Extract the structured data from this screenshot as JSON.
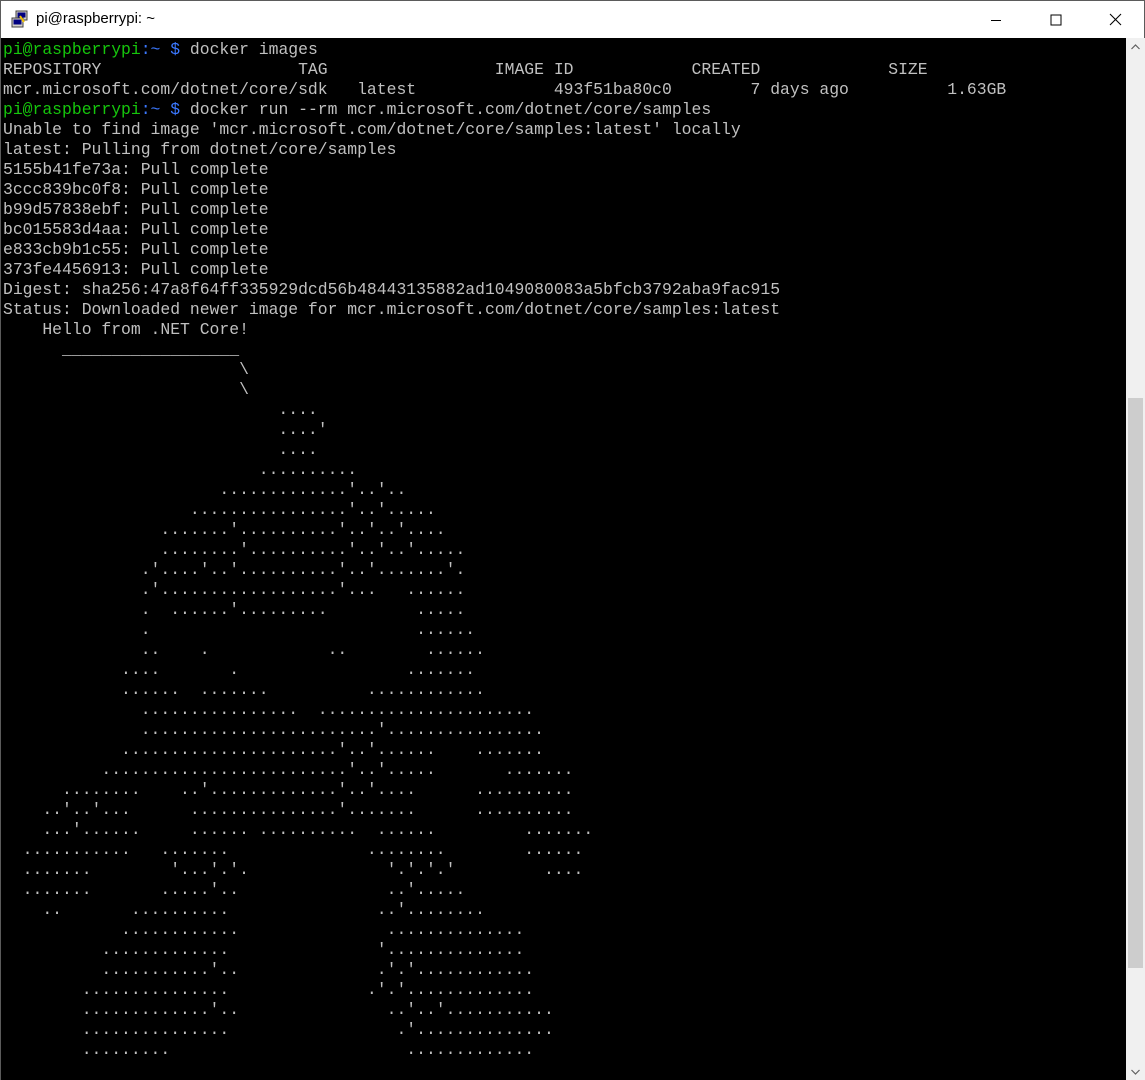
{
  "window": {
    "title": "pi@raspberrypi: ~",
    "icon": "putty-icon",
    "controls": [
      "minimize-icon",
      "maximize-icon",
      "close-icon"
    ]
  },
  "terminal": {
    "colors": {
      "background": "#000000",
      "text": "#c0c0c0",
      "prompt_user": "#16c60c",
      "prompt_path": "#3b78ff"
    },
    "lines": [
      {
        "type": "prompt",
        "user": "pi@raspberrypi",
        "path": ":~ $",
        "command": " docker images"
      },
      {
        "type": "output",
        "text": "REPOSITORY                    TAG                 IMAGE ID            CREATED             SIZE"
      },
      {
        "type": "output",
        "text": "mcr.microsoft.com/dotnet/core/sdk   latest              493f51ba80c0        7 days ago          1.63GB"
      },
      {
        "type": "prompt",
        "user": "pi@raspberrypi",
        "path": ":~ $",
        "command": " docker run --rm mcr.microsoft.com/dotnet/core/samples"
      },
      {
        "type": "output",
        "text": "Unable to find image 'mcr.microsoft.com/dotnet/core/samples:latest' locally"
      },
      {
        "type": "output",
        "text": "latest: Pulling from dotnet/core/samples"
      },
      {
        "type": "output",
        "text": "5155b41fe73a: Pull complete"
      },
      {
        "type": "output",
        "text": "3ccc839bc0f8: Pull complete"
      },
      {
        "type": "output",
        "text": "b99d57838ebf: Pull complete"
      },
      {
        "type": "output",
        "text": "bc015583d4aa: Pull complete"
      },
      {
        "type": "output",
        "text": "e833cb9b1c55: Pull complete"
      },
      {
        "type": "output",
        "text": "373fe4456913: Pull complete"
      },
      {
        "type": "output",
        "text": "Digest: sha256:47a8f64ff335929dcd56b48443135882ad1049080083a5bfcb3792aba9fac915"
      },
      {
        "type": "output",
        "text": "Status: Downloaded newer image for mcr.microsoft.com/dotnet/core/samples:latest"
      },
      {
        "type": "output",
        "text": "    Hello from .NET Core!"
      },
      {
        "type": "output",
        "text": "      __________________"
      },
      {
        "type": "output",
        "text": "                        \\"
      },
      {
        "type": "output",
        "text": "                        \\"
      },
      {
        "type": "output",
        "text": "                            ...."
      },
      {
        "type": "output",
        "text": "                            ....'"
      },
      {
        "type": "output",
        "text": "                            ...."
      },
      {
        "type": "output",
        "text": "                          .........."
      },
      {
        "type": "output",
        "text": "                      .............'..'.."
      },
      {
        "type": "output",
        "text": "                   ................'..'....."
      },
      {
        "type": "output",
        "text": "                .......'..........'..'..'...."
      },
      {
        "type": "output",
        "text": "                ........'..........'..'..'....."
      },
      {
        "type": "output",
        "text": "              .'....'..'..........'..'.......'."
      },
      {
        "type": "output",
        "text": "              .'..................'...   ......"
      },
      {
        "type": "output",
        "text": "              .  ......'.........         ....."
      },
      {
        "type": "output",
        "text": "              .                           ......"
      },
      {
        "type": "output",
        "text": "              ..    .            ..        ......"
      },
      {
        "type": "output",
        "text": "            ....       .                 ......."
      },
      {
        "type": "output",
        "text": "            ......  .......          ............"
      },
      {
        "type": "output",
        "text": "              ................  ......................"
      },
      {
        "type": "output",
        "text": "              ........................'................"
      },
      {
        "type": "output",
        "text": "            ......................'..'......    ......."
      },
      {
        "type": "output",
        "text": "          .........................'..'.....       ......."
      },
      {
        "type": "output",
        "text": "      ........    ..'.............'..'....      .........."
      },
      {
        "type": "output",
        "text": "    ..'..'...      ...............'.......      .........."
      },
      {
        "type": "output",
        "text": "    ...'......     ...... ..........  ......         ......."
      },
      {
        "type": "output",
        "text": "  ...........   .......              ........        ......"
      },
      {
        "type": "output",
        "text": "  .......        '...'.'.              '.'.'.'         ...."
      },
      {
        "type": "output",
        "text": "  .......       .....'..               ..'....."
      },
      {
        "type": "output",
        "text": "    ..       ..........               ..'........"
      },
      {
        "type": "output",
        "text": "            ............               .............."
      },
      {
        "type": "output",
        "text": "          .............               '.............."
      },
      {
        "type": "output",
        "text": "          ...........'..              .'.'............"
      },
      {
        "type": "output",
        "text": "        ...............              .'.'............."
      },
      {
        "type": "output",
        "text": "        .............'..               ..'..'..........."
      },
      {
        "type": "output",
        "text": "        ...............                 .'.............."
      },
      {
        "type": "output",
        "text": "        .........                        ............."
      }
    ]
  },
  "scrollbar": {
    "up": "scroll-up-icon",
    "down": "scroll-down-icon",
    "position": 0.36,
    "visible_fraction": 0.55
  }
}
